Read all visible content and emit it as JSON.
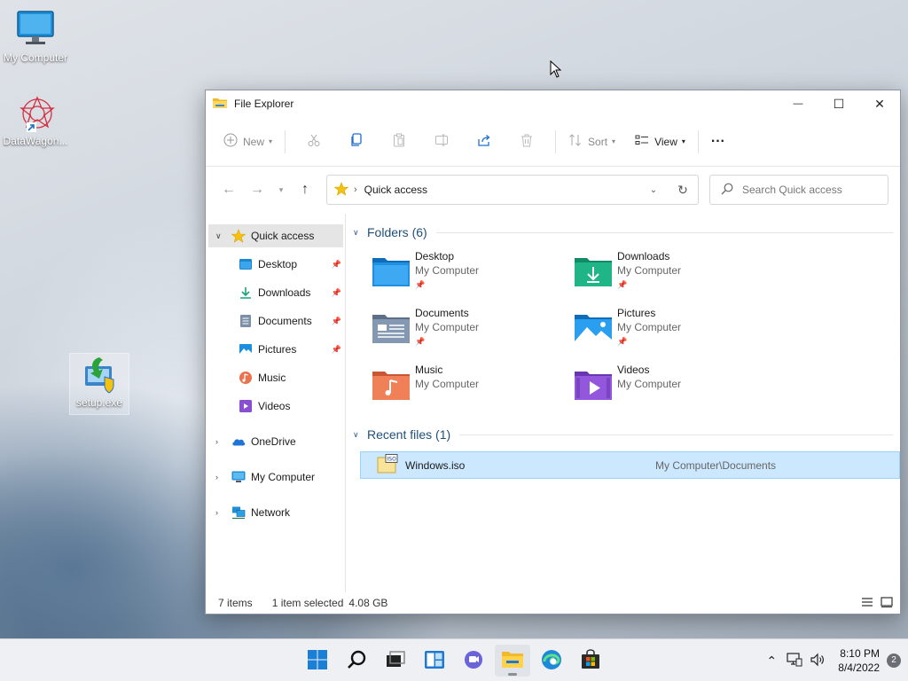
{
  "desktop": {
    "icons": [
      {
        "label": "My Computer"
      },
      {
        "label": "DataWagon..."
      },
      {
        "label": "setup.exe"
      }
    ]
  },
  "window": {
    "title": "File Explorer",
    "controls": {
      "minimize": "—",
      "maximize": "☐",
      "close": "✕"
    }
  },
  "toolbar": {
    "new_label": "New",
    "sort_label": "Sort",
    "view_label": "View",
    "more_label": "···"
  },
  "nav": {
    "location": "Quick access",
    "search_placeholder": "Search Quick access"
  },
  "sidebar": {
    "quick_access": "Quick access",
    "pinned": [
      {
        "label": "Desktop",
        "icon": "desktop-icon",
        "pinned": true
      },
      {
        "label": "Downloads",
        "icon": "download-icon",
        "pinned": true
      },
      {
        "label": "Documents",
        "icon": "document-icon",
        "pinned": true
      },
      {
        "label": "Pictures",
        "icon": "picture-icon",
        "pinned": true
      },
      {
        "label": "Music",
        "icon": "music-icon",
        "pinned": false
      },
      {
        "label": "Videos",
        "icon": "video-icon",
        "pinned": false
      }
    ],
    "onedrive": "OneDrive",
    "my_computer": "My Computer",
    "network": "Network"
  },
  "content": {
    "folders_header": "Folders (6)",
    "folders": [
      {
        "name": "Desktop",
        "location": "My Computer",
        "pinned": true,
        "color": "#1a86d0"
      },
      {
        "name": "Downloads",
        "location": "My Computer",
        "pinned": true,
        "color": "#1aa37a"
      },
      {
        "name": "Documents",
        "location": "My Computer",
        "pinned": true,
        "color": "#7b8fa8"
      },
      {
        "name": "Pictures",
        "location": "My Computer",
        "pinned": true,
        "color": "#1a8fe0"
      },
      {
        "name": "Music",
        "location": "My Computer",
        "pinned": false,
        "color": "#e8734e"
      },
      {
        "name": "Videos",
        "location": "My Computer",
        "pinned": false,
        "color": "#8a4fd1"
      }
    ],
    "recent_header": "Recent files (1)",
    "recent": [
      {
        "name": "Windows.iso",
        "path": "My Computer\\Documents"
      }
    ]
  },
  "status": {
    "items": "7 items",
    "selected": "1 item selected",
    "size": "4.08 GB"
  },
  "taskbar": {
    "time": "8:10 PM",
    "date": "8/4/2022",
    "notifications": "2"
  }
}
